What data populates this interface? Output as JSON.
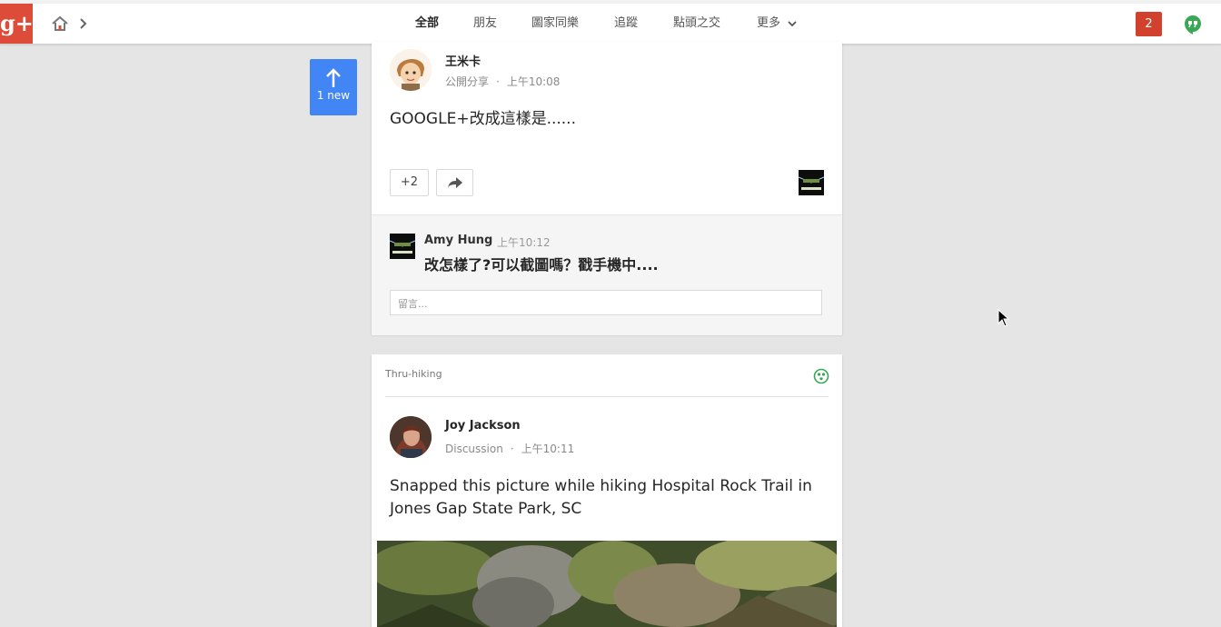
{
  "header": {
    "tabs": [
      {
        "label": "全部"
      },
      {
        "label": "朋友"
      },
      {
        "label": "圖家同樂"
      },
      {
        "label": "追蹤"
      },
      {
        "label": "點頭之交"
      },
      {
        "label": "更多"
      }
    ],
    "active_tab": "全部",
    "notification_count": "2",
    "accent_color": "#4285f4",
    "brand_color": "#dd4b39"
  },
  "new_posts": {
    "label": "1 new"
  },
  "posts": [
    {
      "author": "王米卡",
      "visibility": "公開分享",
      "time": "上午10:08",
      "text": "GOOGLE+改成這樣是......",
      "plus_count": "+2",
      "comment": {
        "author": "Amy Hung",
        "time": "上午10:12",
        "text": "改怎樣了?可以截圖嗎？戳手機中...."
      },
      "reply_placeholder": "留言..."
    },
    {
      "community": "Thru-hiking",
      "author": "Joy Jackson",
      "category": "Discussion",
      "time": "上午10:11",
      "text": "Snapped this picture while hiking Hospital Rock Trail in Jones Gap State Park, SC"
    }
  ]
}
